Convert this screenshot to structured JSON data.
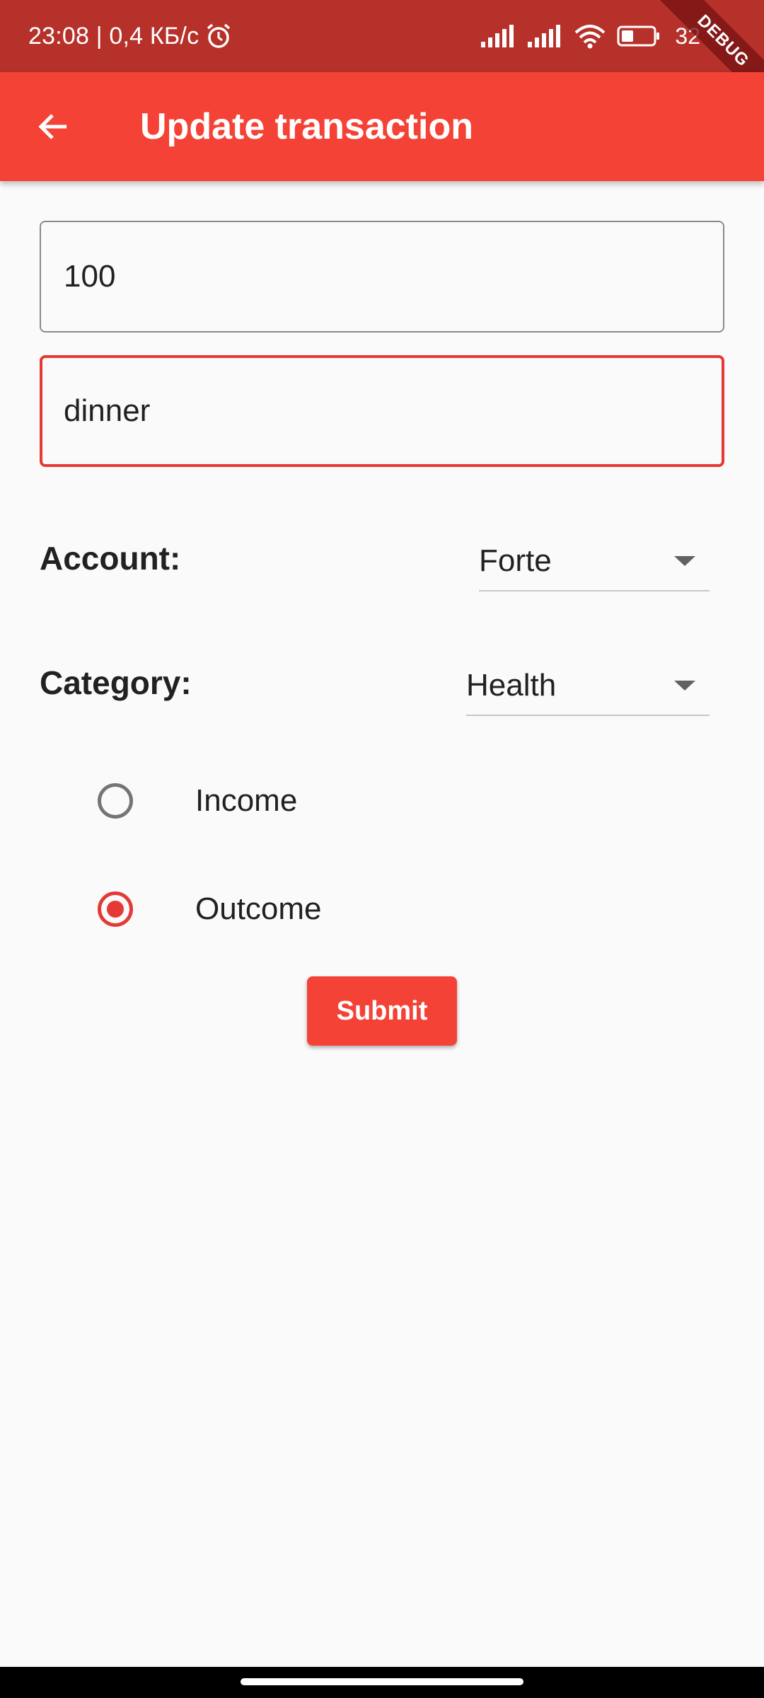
{
  "status_bar": {
    "time_speed": "23:08 | 0,4 КБ/с",
    "battery_percent": "32",
    "debug_label": "DEBUG"
  },
  "app_bar": {
    "title": "Update transaction"
  },
  "form": {
    "amount_value": "100",
    "description_value": "dinner",
    "account_label": "Account:",
    "account_selected": "Forte",
    "category_label": "Category:",
    "category_selected": "Health",
    "radio_income_label": "Income",
    "radio_outcome_label": "Outcome",
    "selected_type": "Outcome",
    "submit_label": "Submit"
  },
  "colors": {
    "primary": "#f44336",
    "status_bar": "#b7312b",
    "error_border": "#e53935"
  }
}
